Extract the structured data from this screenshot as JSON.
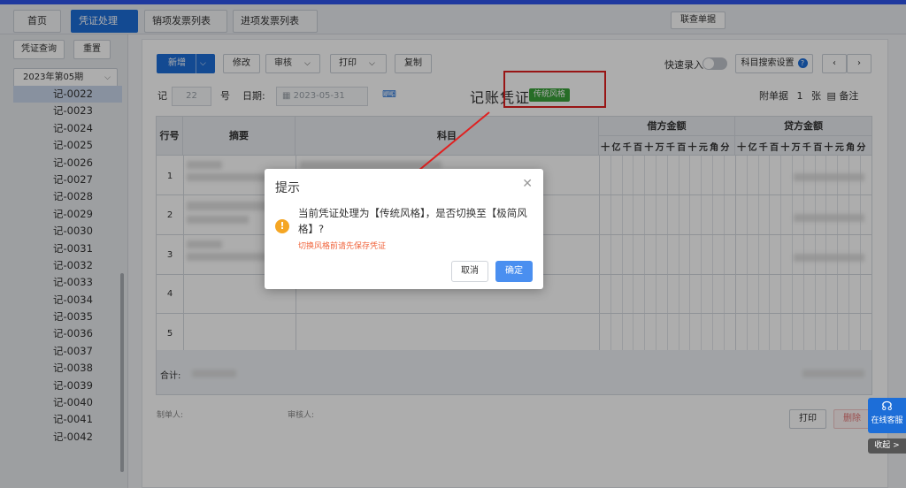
{
  "tabs": [
    {
      "label": "首页",
      "closable": false,
      "active": false
    },
    {
      "label": "凭证处理",
      "closable": true,
      "active": true
    },
    {
      "label": "销项发票列表",
      "closable": true,
      "active": false
    },
    {
      "label": "进项发票列表",
      "closable": true,
      "active": false
    }
  ],
  "header": {
    "linked_docs_label": "联查单据"
  },
  "sidebar": {
    "query_label": "凭证查询",
    "reset_label": "重置",
    "period": "2023年第05期",
    "vouchers": [
      "记-0022",
      "记-0023",
      "记-0024",
      "记-0025",
      "记-0026",
      "记-0027",
      "记-0028",
      "记-0029",
      "记-0030",
      "记-0031",
      "记-0032",
      "记-0033",
      "记-0034",
      "记-0035",
      "记-0036",
      "记-0037",
      "记-0038",
      "记-0039",
      "记-0040",
      "记-0041",
      "记-0042"
    ],
    "selected_index": 0
  },
  "toolbar": {
    "new_label": "新增",
    "edit_label": "修改",
    "audit_label": "审核",
    "print_label": "打印",
    "copy_label": "复制",
    "quick_entry_label": "快速录入",
    "subject_search_label": "科目搜索设置",
    "prev_icon": "chevron-left-icon",
    "next_icon": "chevron-right-icon"
  },
  "voucher": {
    "word": "记",
    "number": "22",
    "number_suffix": "号",
    "date_label": "日期:",
    "date": "2023-05-31",
    "title": "记账凭证",
    "style_tag": "传统风格",
    "attachments_label": "附单据",
    "attachments_count": "1",
    "attachments_unit": "张",
    "remark_label": "备注"
  },
  "table": {
    "col_row": "行号",
    "col_summary": "摘要",
    "col_subject": "科目",
    "col_debit": "借方金额",
    "col_credit": "贷方金额",
    "digit_units": [
      "十",
      "亿",
      "千",
      "百",
      "十",
      "万",
      "千",
      "百",
      "十",
      "元",
      "角",
      "分"
    ],
    "rows": [
      "1",
      "2",
      "3",
      "4",
      "5"
    ],
    "total_label": "合计:"
  },
  "footer": {
    "maker_label": "制单人:",
    "auditor_label": "审核人:",
    "print_label": "打印",
    "delete_label": "删除"
  },
  "dialog": {
    "title": "提示",
    "message": "当前凭证处理为【传统风格】，是否切换至【极简风格】?",
    "note": "切换风格前请先保存凭证",
    "cancel_label": "取消",
    "ok_label": "确定"
  },
  "widgets": {
    "service_label": "在线客服",
    "collapse_label": "收起 >"
  },
  "colors": {
    "primary": "#1d6ed8",
    "tag_green": "#3aa13a",
    "annotation_red": "#e02020",
    "warning": "#f5a623"
  }
}
